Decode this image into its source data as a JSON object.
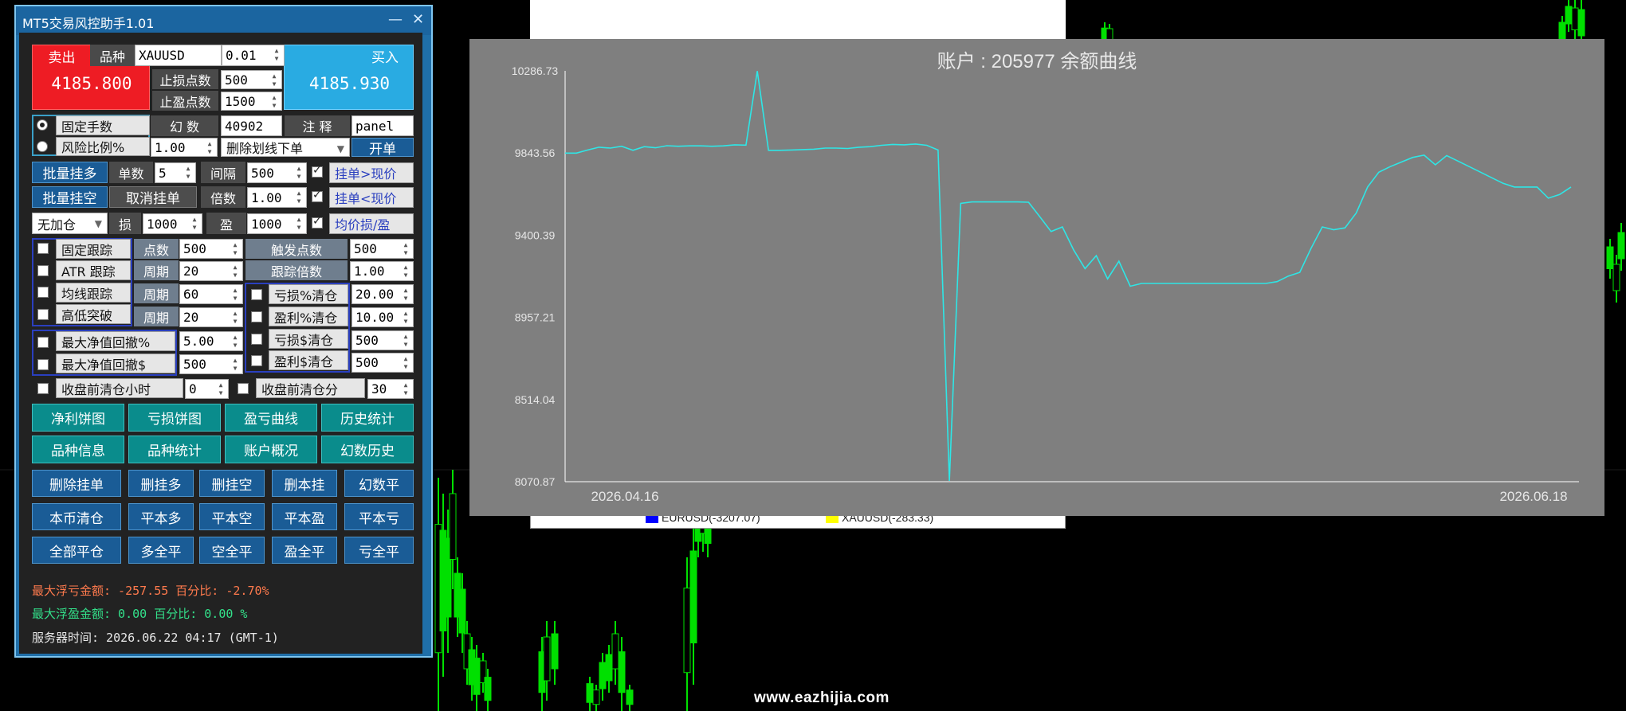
{
  "panel": {
    "title": "MT5交易风控助手1.01",
    "min_glyph": "—",
    "close_glyph": "✕",
    "sell_label": "卖出",
    "symbol_label": "品种",
    "symbol_value": "XAUUSD",
    "lots_label": "手数",
    "lots_value": "0.01",
    "buy_label": "买入",
    "sell_price": "4185.800",
    "buy_price": "4185.930",
    "sl_points_label": "止损点数",
    "sl_points_value": "500",
    "tp_points_label": "止盈点数",
    "tp_points_value": "1500",
    "fixed_lots_label": "固定手数",
    "risk_ratio_label": "风险比例%",
    "risk_ratio_value": "1.00",
    "magic_label": "幻 数",
    "magic_value": "40902",
    "comment_label": "注 释",
    "comment_value": "panel",
    "line_mode_value": "删除划线下单",
    "open_label": "开单",
    "batch_buy_label": "批量挂多",
    "order_count_label": "单数",
    "order_count_value": "5",
    "interval_label": "间隔",
    "interval_value": "500",
    "pending_above_label": "挂单>现价",
    "batch_sell_label": "批量挂空",
    "cancel_pending_label": "取消挂单",
    "multiplier_label": "倍数",
    "multiplier_value": "1.00",
    "pending_below_label": "挂单<现价",
    "add_position_value": "无加仓",
    "loss_label": "损",
    "loss_value": "1000",
    "profit_label": "盈",
    "profit_value": "1000",
    "avg_price_label": "均价损/盈",
    "fixed_trail_label": "固定跟踪",
    "atr_trail_label": "ATR 跟踪",
    "ma_trail_label": "均线跟踪",
    "hl_break_label": "高低突破",
    "points_label": "点数",
    "points_value": "500",
    "period_label": "周期",
    "period1_value": "20",
    "period2_value": "60",
    "period3_value": "20",
    "trigger_points_label": "触发点数",
    "trigger_points_value": "500",
    "trail_multiplier_label": "跟踪倍数",
    "trail_multiplier_value": "1.00",
    "loss_pct_close_label": "亏损%清仓",
    "loss_pct_close_value": "20.00",
    "profit_pct_close_label": "盈利%清仓",
    "profit_pct_close_value": "10.00",
    "loss_usd_close_label": "亏损$清仓",
    "loss_usd_close_value": "500",
    "profit_usd_close_label": "盈利$清仓",
    "profit_usd_close_value": "500",
    "max_dd_pct_label": "最大净值回撤%",
    "max_dd_pct_value": "5.00",
    "max_dd_usd_label": "最大净值回撤$",
    "max_dd_usd_value": "500",
    "close_hours_label": "收盘前清仓小时",
    "close_hours_value": "0",
    "close_minutes_label": "收盘前清仓分",
    "close_minutes_value": "30",
    "teal_buttons": [
      "净利饼图",
      "亏损饼图",
      "盈亏曲线",
      "历史统计",
      "品种信息",
      "品种统计",
      "账户概况",
      "幻数历史"
    ],
    "blue_buttons": [
      "删除挂单",
      "删挂多",
      "删挂空",
      "删本挂",
      "幻数平",
      "本币清仓",
      "平本多",
      "平本空",
      "平本盈",
      "平本亏",
      "全部平仓",
      "多全平",
      "空全平",
      "盈全平",
      "亏全平"
    ],
    "status_loss": "最大浮亏金额: -257.55 百分比: -2.70%",
    "status_profit": "最大浮盈金额: 0.00  百分比:  0.00 %",
    "server_time": "服务器时间: 2026.06.22 04:17 (GMT-1)"
  },
  "background_legend": {
    "item1": "EURUSD(-3207.07)",
    "item2": "XAUUSD(-283.33)",
    "item1_color": "#0000ff",
    "item2_color": "#ffff00"
  },
  "watermark": "www.eazhijia.com",
  "chart_data": {
    "type": "line",
    "title": "账户 : 205977  余额曲线",
    "ylim": [
      8070.87,
      10286.73
    ],
    "yticks": [
      "10286.73",
      "9843.56",
      "9400.39",
      "8957.21",
      "8514.04",
      "8070.87"
    ],
    "xticks": [
      "2026.04.16",
      "2026.06.18"
    ],
    "line_color": "#2ee6e6",
    "series": [
      {
        "values": [
          9843,
          9843,
          9860,
          9875,
          9870,
          9880,
          9858,
          9878,
          9872,
          9883,
          9880,
          9882,
          9882,
          9880,
          9882,
          9888,
          9886,
          10286,
          9858,
          9858,
          9860,
          9862,
          9864,
          9870,
          9870,
          9868,
          9875,
          9878,
          9885,
          9890,
          9888,
          9892,
          9885,
          9860,
          8075,
          9572,
          9580,
          9580,
          9580,
          9580,
          9580,
          9578,
          9500,
          9420,
          9445,
          9320,
          9220,
          9290,
          9165,
          9260,
          9125,
          9140,
          9140,
          9140,
          9140,
          9140,
          9140,
          9140,
          9140,
          9140,
          9140,
          9140,
          9140,
          9150,
          9180,
          9200,
          9330,
          9445,
          9430,
          9440,
          9520,
          9660,
          9740,
          9770,
          9795,
          9820,
          9832,
          9780,
          9830,
          9800,
          9770,
          9740,
          9710,
          9680,
          9660,
          9660,
          9660,
          9600,
          9620,
          9660
        ]
      }
    ]
  }
}
